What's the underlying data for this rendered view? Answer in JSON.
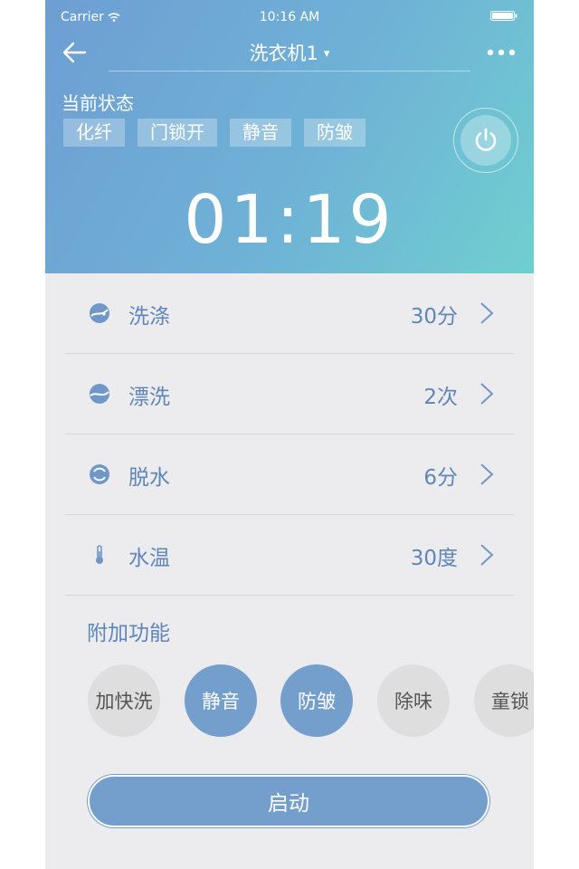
{
  "status_bar": {
    "carrier": "Carrier",
    "time": "10:16 AM"
  },
  "nav": {
    "title": "洗衣机1",
    "caret": "▾"
  },
  "state": {
    "label": "当前状态",
    "tags": [
      "化纤",
      "门锁开",
      "静音",
      "防皱"
    ]
  },
  "timer": "01:19",
  "settings": [
    {
      "label": "洗涤",
      "value": "30分",
      "icon": "wash-icon"
    },
    {
      "label": "漂洗",
      "value": "2次",
      "icon": "rinse-icon"
    },
    {
      "label": "脱水",
      "value": "6分",
      "icon": "spin-icon"
    },
    {
      "label": "水温",
      "value": "30度",
      "icon": "thermometer-icon"
    }
  ],
  "extra": {
    "title": "附加功能",
    "features": [
      {
        "label": "加快洗",
        "active": false
      },
      {
        "label": "静音",
        "active": true
      },
      {
        "label": "防皱",
        "active": true
      },
      {
        "label": "除味",
        "active": false
      },
      {
        "label": "童锁",
        "active": false
      }
    ]
  },
  "start_label": "启动",
  "colors": {
    "accent": "#749fcd",
    "text_accent": "#5f86b8",
    "header_start": "#6e9ed3",
    "header_end": "#6fcfd0"
  }
}
